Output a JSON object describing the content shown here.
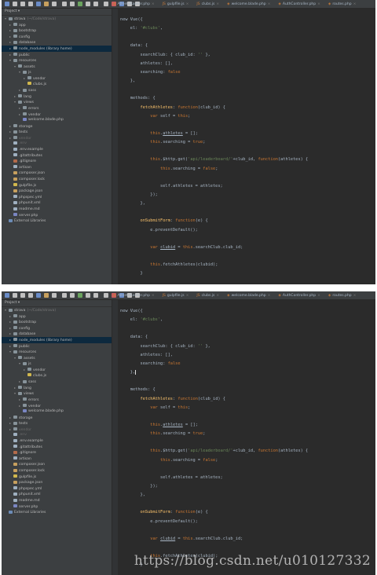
{
  "tabs": [
    {
      "ext": "php",
      "label": "AthleteRanker.php"
    },
    {
      "ext": "js",
      "label": "gulpfile.js"
    },
    {
      "ext": "js",
      "label": "clubs.js"
    },
    {
      "ext": "php",
      "label": "welcome.blade.php"
    },
    {
      "ext": "php",
      "label": "AuthController.php"
    },
    {
      "ext": "php",
      "label": "routes.php"
    }
  ],
  "project_header": "Project",
  "tree": [
    {
      "label": "strava",
      "extra": "~/Code/strava",
      "icon": "folder",
      "depth": 0,
      "arrow": "▾"
    },
    {
      "label": "app",
      "icon": "folder",
      "depth": 1,
      "arrow": "▸"
    },
    {
      "label": "bootstrap",
      "icon": "folder",
      "depth": 1,
      "arrow": "▸"
    },
    {
      "label": "config",
      "icon": "folder",
      "depth": 1,
      "arrow": "▸"
    },
    {
      "label": "database",
      "icon": "folder",
      "depth": 1,
      "arrow": "▸"
    },
    {
      "label": "node_modules (library home)",
      "icon": "folder",
      "depth": 1,
      "arrow": "▸",
      "sel": true
    },
    {
      "label": "public",
      "icon": "folder",
      "depth": 1,
      "arrow": "▸"
    },
    {
      "label": "resources",
      "icon": "folder",
      "depth": 1,
      "arrow": "▾"
    },
    {
      "label": "assets",
      "icon": "folder",
      "depth": 2,
      "arrow": "▾"
    },
    {
      "label": "js",
      "icon": "folder",
      "depth": 3,
      "arrow": "▾"
    },
    {
      "label": "vendor",
      "icon": "folder",
      "depth": 4,
      "arrow": "▸"
    },
    {
      "label": "clubs.js",
      "icon": "js",
      "depth": 4,
      "arrow": ""
    },
    {
      "label": "sass",
      "icon": "folder",
      "depth": 3,
      "arrow": "▸"
    },
    {
      "label": "lang",
      "icon": "folder",
      "depth": 2,
      "arrow": "▸"
    },
    {
      "label": "views",
      "icon": "folder",
      "depth": 2,
      "arrow": "▾"
    },
    {
      "label": "errors",
      "icon": "folder",
      "depth": 3,
      "arrow": "▸"
    },
    {
      "label": "vendor",
      "icon": "folder",
      "depth": 3,
      "arrow": "▸"
    },
    {
      "label": "welcome.blade.php",
      "icon": "php",
      "depth": 3,
      "arrow": ""
    },
    {
      "label": "storage",
      "icon": "folder",
      "depth": 1,
      "arrow": "▸"
    },
    {
      "label": "tests",
      "icon": "folder",
      "depth": 1,
      "arrow": "▸"
    },
    {
      "label": "vendor",
      "icon": "folder",
      "depth": 1,
      "arrow": "▸",
      "dim": true
    },
    {
      "label": ".env",
      "icon": "file",
      "depth": 1,
      "arrow": "",
      "dim": true
    },
    {
      "label": ".env.example",
      "icon": "file",
      "depth": 1,
      "arrow": ""
    },
    {
      "label": ".gitattributes",
      "icon": "file",
      "depth": 1,
      "arrow": ""
    },
    {
      "label": ".gitignore",
      "icon": "git",
      "depth": 1,
      "arrow": ""
    },
    {
      "label": "artisan",
      "icon": "file",
      "depth": 1,
      "arrow": ""
    },
    {
      "label": "composer.json",
      "icon": "json",
      "depth": 1,
      "arrow": ""
    },
    {
      "label": "composer.lock",
      "icon": "json",
      "depth": 1,
      "arrow": ""
    },
    {
      "label": "gulpfile.js",
      "icon": "js",
      "depth": 1,
      "arrow": ""
    },
    {
      "label": "package.json",
      "icon": "json",
      "depth": 1,
      "arrow": ""
    },
    {
      "label": "phpspec.yml",
      "icon": "file",
      "depth": 1,
      "arrow": ""
    },
    {
      "label": "phpunit.xml",
      "icon": "file",
      "depth": 1,
      "arrow": ""
    },
    {
      "label": "readme.md",
      "icon": "file",
      "depth": 1,
      "arrow": ""
    },
    {
      "label": "server.php",
      "icon": "php",
      "depth": 1,
      "arrow": ""
    },
    {
      "label": "External Libraries",
      "icon": "lib",
      "depth": 0,
      "arrow": ""
    }
  ],
  "code": [
    [
      [
        "",
        "new Vue({"
      ]
    ],
    [
      [
        "",
        "    el: "
      ],
      [
        "str",
        "'#clubs'"
      ],
      [
        "",
        ","
      ]
    ],
    [],
    [
      [
        "",
        "    data: {"
      ]
    ],
    [
      [
        "",
        "        searchClub: { club_id: "
      ],
      [
        "str",
        "''"
      ],
      [
        "",
        " },"
      ]
    ],
    [
      [
        "",
        "        athletes: [],"
      ]
    ],
    [
      [
        "",
        "        searching: "
      ],
      [
        "kw",
        "false"
      ]
    ],
    [
      [
        "",
        "    },"
      ]
    ],
    [],
    [
      [
        "",
        "    methods: {"
      ]
    ],
    [
      [
        "",
        "        "
      ],
      [
        "fn",
        "fetchAthletes"
      ],
      [
        "",
        ": "
      ],
      [
        "kw",
        "function"
      ],
      [
        "",
        "(club_id) {"
      ]
    ],
    [
      [
        "",
        "            "
      ],
      [
        "kw",
        "var"
      ],
      [
        "",
        " self = "
      ],
      [
        "kw",
        "this"
      ],
      [
        "",
        ";"
      ]
    ],
    [],
    [
      [
        "",
        "            "
      ],
      [
        "kw",
        "this"
      ],
      [
        "",
        "."
      ],
      [
        "ul",
        "athletes"
      ],
      [
        "",
        " = [];"
      ]
    ],
    [
      [
        "",
        "            "
      ],
      [
        "kw",
        "this"
      ],
      [
        "",
        ".searching = "
      ],
      [
        "kw",
        "true"
      ],
      [
        "",
        ";"
      ]
    ],
    [],
    [
      [
        "",
        "            "
      ],
      [
        "kw",
        "this"
      ],
      [
        "",
        ".$http.get("
      ],
      [
        "str",
        "'api/leaderboard/'"
      ],
      [
        "",
        "+club_id, "
      ],
      [
        "kw",
        "function"
      ],
      [
        "",
        "(athletes) {"
      ]
    ],
    [
      [
        "",
        "                "
      ],
      [
        "kw",
        "this"
      ],
      [
        "",
        ".searching = "
      ],
      [
        "kw",
        "false"
      ],
      [
        "",
        ";"
      ]
    ],
    [],
    [
      [
        "",
        "                self.athletes = athletes;"
      ]
    ],
    [
      [
        "",
        "            });"
      ]
    ],
    [
      [
        "",
        "        },"
      ]
    ],
    [],
    [
      [
        "",
        "        "
      ],
      [
        "fn",
        "onSubmitForm"
      ],
      [
        "",
        ": "
      ],
      [
        "kw",
        "function"
      ],
      [
        "",
        "(e) {"
      ]
    ],
    [
      [
        "",
        "            e.preventDefault();"
      ]
    ],
    [],
    [
      [
        "",
        "            "
      ],
      [
        "kw",
        "var"
      ],
      [
        "",
        " "
      ],
      [
        "ul",
        "clubid"
      ],
      [
        "",
        " = "
      ],
      [
        "kw",
        "this"
      ],
      [
        "",
        ".searchClub.club_id;"
      ]
    ],
    [],
    [
      [
        "",
        "            "
      ],
      [
        "kw",
        "this"
      ],
      [
        "",
        ".fetchAthletes(clubid);"
      ]
    ],
    [
      [
        "",
        "        }"
      ]
    ]
  ],
  "watermark": "https://blog.csdn.net/u010127332"
}
